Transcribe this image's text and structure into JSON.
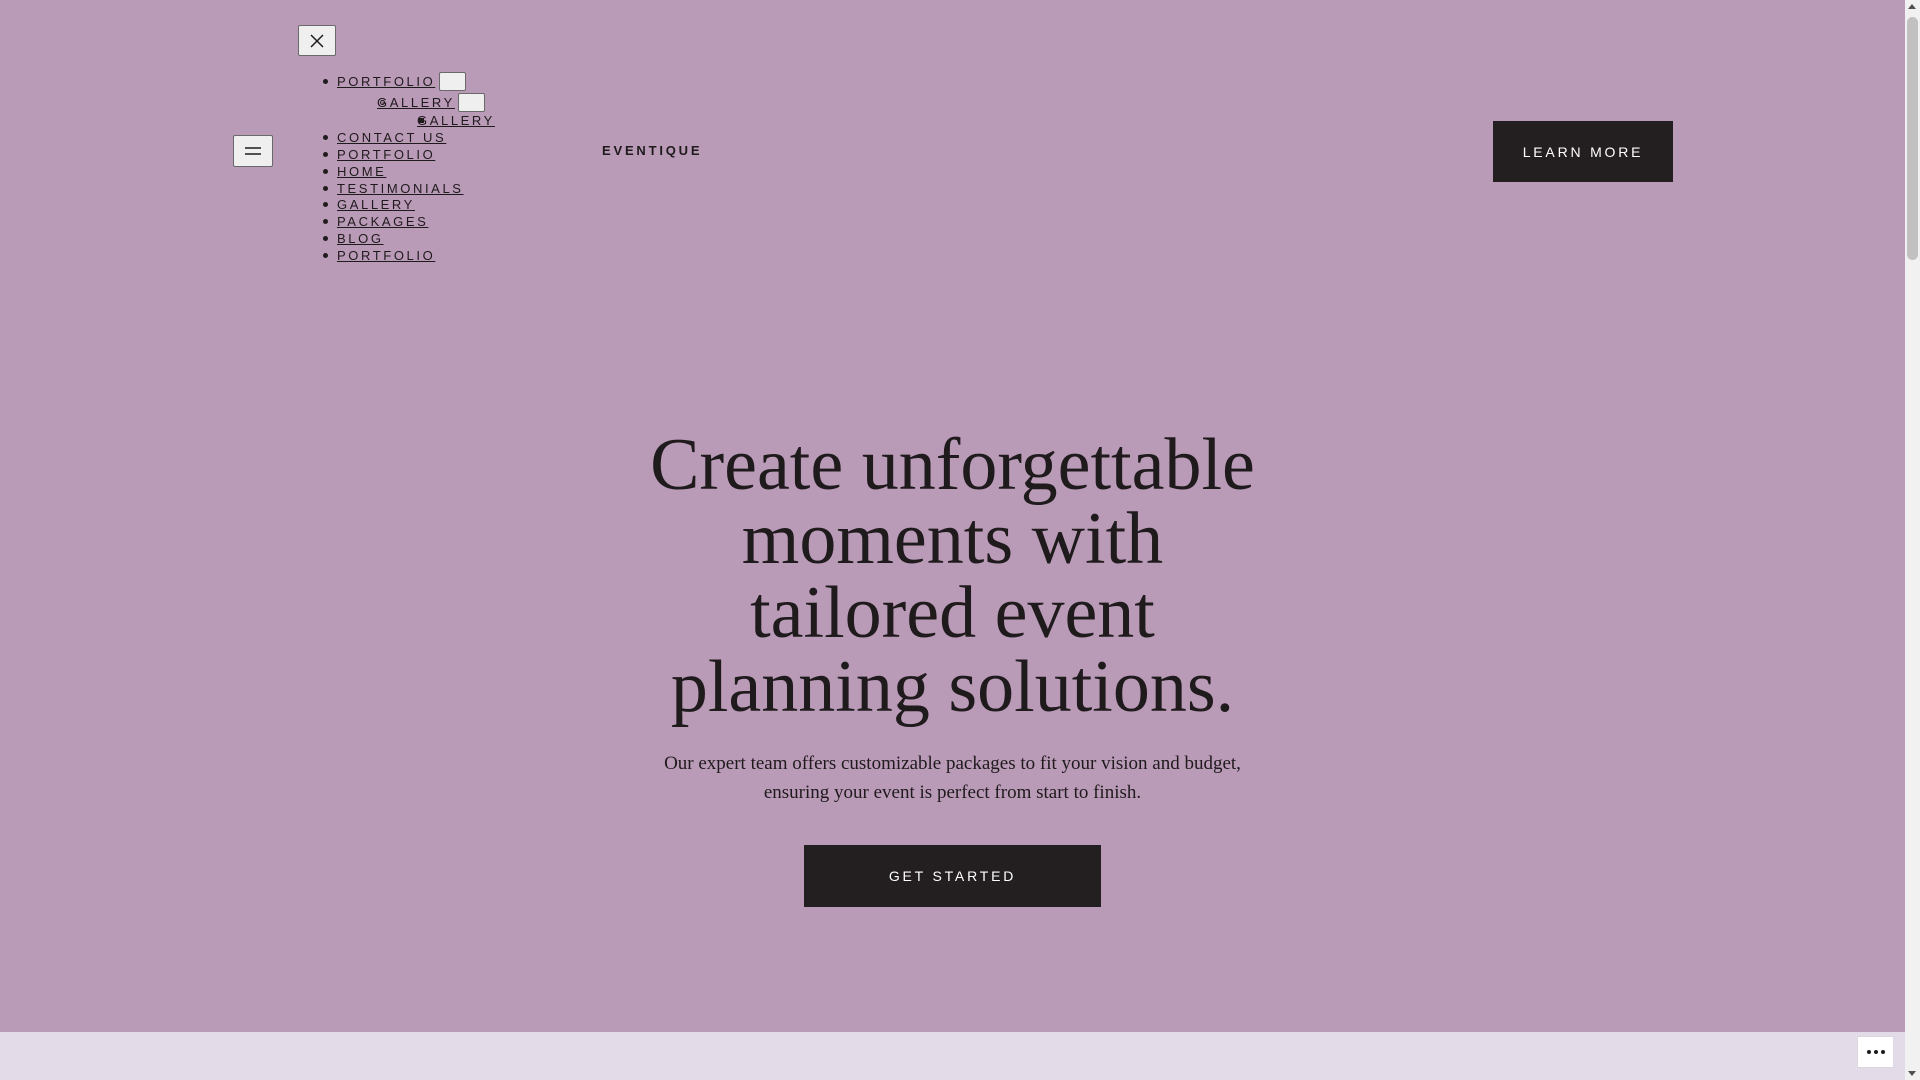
{
  "header": {
    "site_title": "EVENTIQUE",
    "cta_label": "LEARN MORE",
    "close_icon": "close-icon",
    "menu_icon": "hamburger-icon"
  },
  "nav": {
    "submenu_top": [
      {
        "label": "PORTFOLIO"
      },
      {
        "label": "GALLERY"
      },
      {
        "label": "GALLERY"
      }
    ],
    "items": [
      {
        "label": "CONTACT US"
      },
      {
        "label": "PORTFOLIO"
      },
      {
        "label": "HOME"
      },
      {
        "label": "TESTIMONIALS"
      },
      {
        "label": "GALLERY"
      },
      {
        "label": "PACKAGES"
      },
      {
        "label": "BLOG"
      },
      {
        "label": "PORTFOLIO"
      }
    ]
  },
  "hero": {
    "title_lines": [
      "Create unforgettable",
      "moments with",
      "tailored event",
      "planning solutions."
    ],
    "subtitle_lines": [
      "Our expert team offers customizable packages to fit your vision and budget,",
      "ensuring your event is perfect from start to finish."
    ],
    "button_label": "GET STARTED"
  },
  "footer_bar": {
    "more_icon": "more-options-icon"
  },
  "colors": {
    "background": "#b99ab7",
    "button_dark": "#231f21",
    "bottom_band": "#e4dbe9"
  }
}
